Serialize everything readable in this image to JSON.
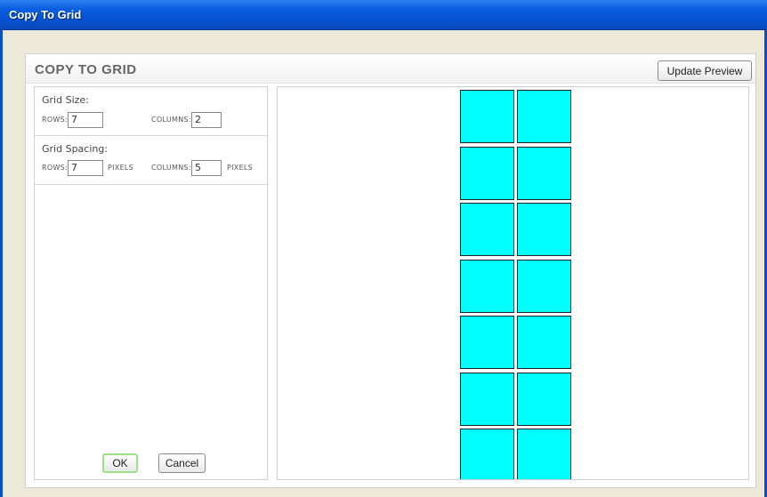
{
  "window": {
    "title": "Copy To Grid"
  },
  "panel": {
    "title": "COPY TO GRID",
    "update_preview_label": "Update Preview"
  },
  "grid_size": {
    "heading": "Grid Size:",
    "rows_label": "ROWS:",
    "rows_value": "7",
    "columns_label": "COLUMNS:",
    "columns_value": "2"
  },
  "grid_spacing": {
    "heading": "Grid Spacing:",
    "rows_label": "ROWS:",
    "rows_value": "7",
    "rows_unit": "PIXELS",
    "columns_label": "COLUMNS:",
    "columns_value": "5",
    "columns_unit": "PIXELS"
  },
  "actions": {
    "ok_label": "OK",
    "cancel_label": "Cancel"
  },
  "preview": {
    "rows": 7,
    "columns": 2,
    "cell_color": "#00ffff"
  }
}
